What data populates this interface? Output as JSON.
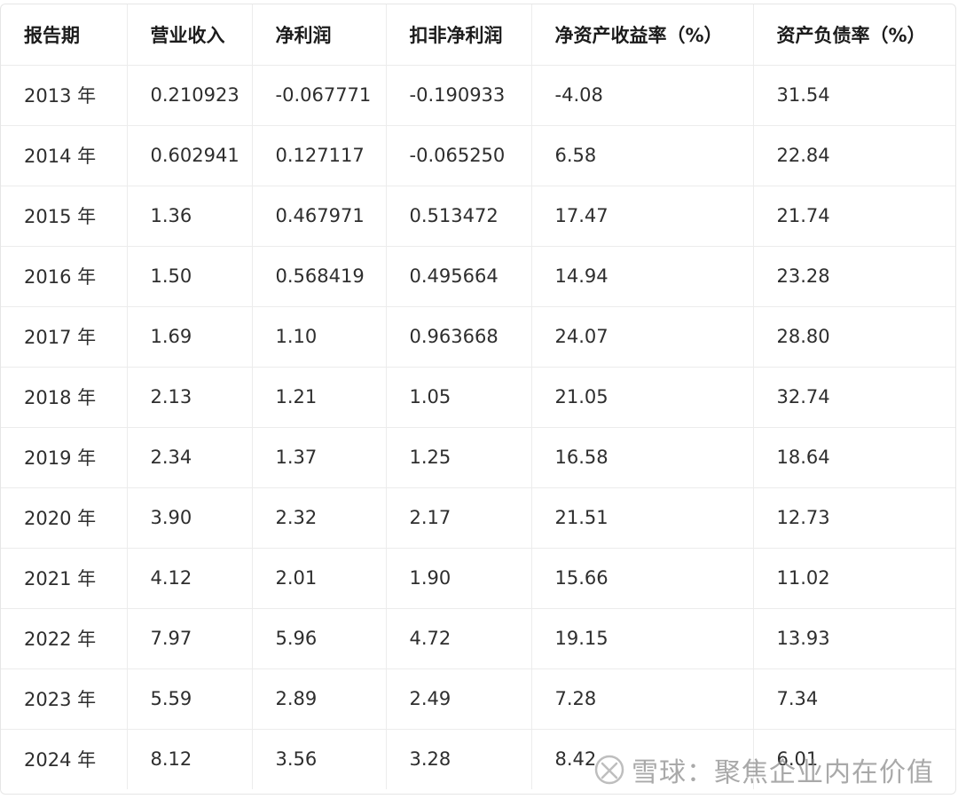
{
  "table": {
    "headers": [
      "报告期",
      "营业收入",
      "净利润",
      "扣非净利润",
      "净资产收益率（%）",
      "资产负债率（%）"
    ],
    "rows": [
      [
        "2013 年",
        "0.210923",
        "-0.067771",
        "-0.190933",
        "-4.08",
        "31.54"
      ],
      [
        "2014 年",
        "0.602941",
        "0.127117",
        "-0.065250",
        "6.58",
        "22.84"
      ],
      [
        "2015 年",
        "1.36",
        "0.467971",
        "0.513472",
        "17.47",
        "21.74"
      ],
      [
        "2016 年",
        "1.50",
        "0.568419",
        "0.495664",
        "14.94",
        "23.28"
      ],
      [
        "2017 年",
        "1.69",
        "1.10",
        "0.963668",
        "24.07",
        "28.80"
      ],
      [
        "2018 年",
        "2.13",
        "1.21",
        "1.05",
        "21.05",
        "32.74"
      ],
      [
        "2019 年",
        "2.34",
        "1.37",
        "1.25",
        "16.58",
        "18.64"
      ],
      [
        "2020 年",
        "3.90",
        "2.32",
        "2.17",
        "21.51",
        "12.73"
      ],
      [
        "2021 年",
        "4.12",
        "2.01",
        "1.90",
        "15.66",
        "11.02"
      ],
      [
        "2022 年",
        "7.97",
        "5.96",
        "4.72",
        "19.15",
        "13.93"
      ],
      [
        "2023 年",
        "5.59",
        "2.89",
        "2.49",
        "7.28",
        "7.34"
      ],
      [
        "2024 年",
        "8.12",
        "3.56",
        "3.28",
        "8.42",
        "6.01"
      ]
    ]
  },
  "watermark": {
    "text": "雪球：聚焦企业内在价值",
    "logo_icon": "xueqiu-logo-icon"
  }
}
